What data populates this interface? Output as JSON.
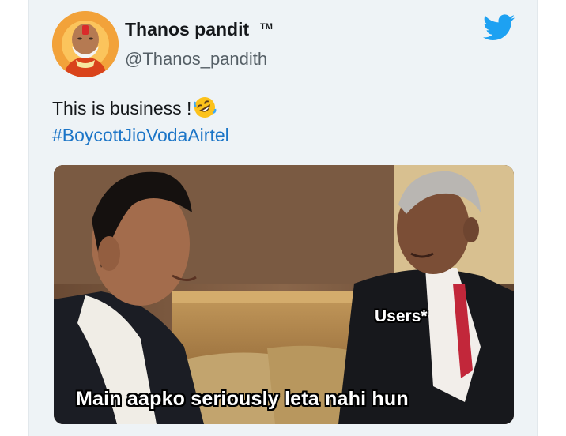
{
  "tweet": {
    "display_name": "Thanos pandit",
    "tm_mark": "TM",
    "handle": "@Thanos_pandith",
    "text": "This is business !",
    "hashtag": "#BoycottJioVodaAirtel"
  },
  "media": {
    "label": "Users*",
    "caption": "Main aapko seriously leta nahi hun"
  },
  "colors": {
    "twitter_blue": "#1da1f2",
    "hashtag_blue": "#1b75c7",
    "card_bg": "#eef3f6"
  },
  "icons": {
    "brand": "twitter-bird-icon",
    "emoji": "rolling-on-floor-laughing-emoji"
  }
}
